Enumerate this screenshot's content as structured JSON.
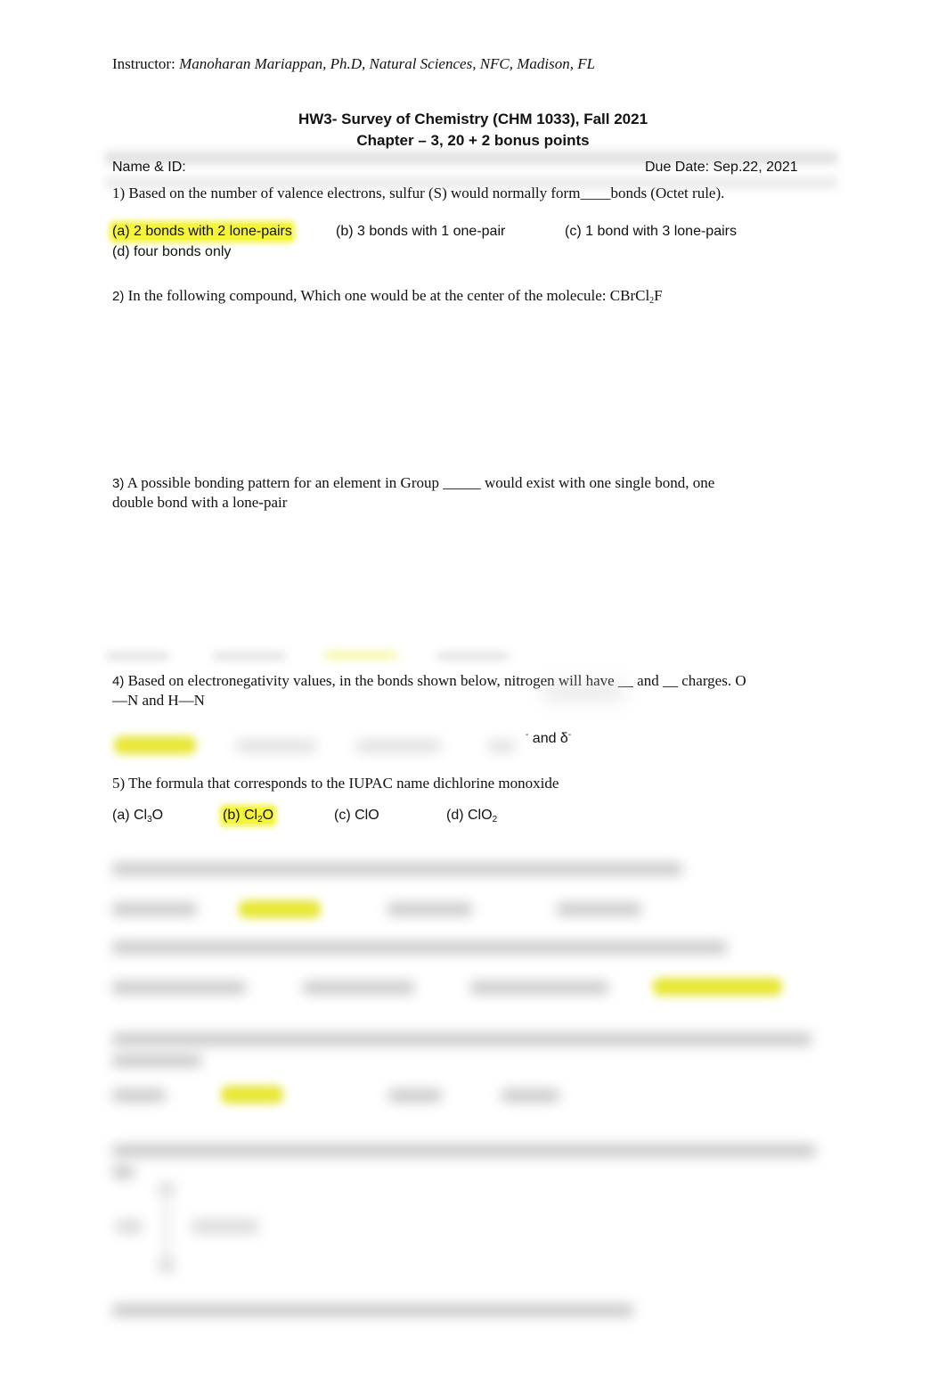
{
  "header": {
    "instructor_label": "Instructor: ",
    "instructor_value": "Manoharan Mariappan, Ph.D, Natural Sciences, NFC, Madison, FL",
    "title_line1": "HW3- Survey of Chemistry (CHM 1033), Fall 2021",
    "title_line2": "Chapter – 3, 20 + 2 bonus points",
    "name_id_label": "Name & ID:",
    "due_date": "Due Date: Sep.22, 2021"
  },
  "questions": {
    "q1": {
      "text": "1) Based on the number of valence electrons, sulfur (S) would normally form____bonds (Octet rule).",
      "options": [
        {
          "label": "(a) 2 bonds with 2 lone-pairs",
          "highlighted": true
        },
        {
          "label": "(b) 3 bonds with 1 one-pair",
          "highlighted": false
        },
        {
          "label": "(c) 1 bond with 3 lone-pairs",
          "highlighted": false
        },
        {
          "label": "(d) four bonds only",
          "highlighted": false
        }
      ]
    },
    "q2": {
      "number": "2)",
      "text": " In the following compound, Which one would be at the center of the molecule: ",
      "formula_pre": "CBrCl",
      "formula_sub": "2",
      "formula_post": "F"
    },
    "q3": {
      "number": "3)",
      "text_line1": " A possible bonding pattern for an element in Group _____ would exist with one single bond, one",
      "text_line2": "double bond with a lone-pair"
    },
    "q4": {
      "number": "4)",
      "text_line1": " Based on electronegativity values, in the bonds shown below, nitrogen will have __ and __ charges.  O",
      "text_line2": "—N   and H—N",
      "visible_option_fragment": " and δ",
      "visible_sup_pre": "-",
      "visible_sup_post": "-"
    },
    "q5": {
      "text": "5) The formula that corresponds to the IUPAC name dichlorine monoxide",
      "options": [
        {
          "prefix": "(a) Cl",
          "sub": "3",
          "suffix": "O",
          "highlighted": false
        },
        {
          "prefix": "(b) Cl",
          "sub": "2",
          "suffix": "O",
          "highlighted": true
        },
        {
          "prefix": "(c) ClO",
          "sub": "",
          "suffix": "",
          "highlighted": false
        },
        {
          "prefix": "(d) ClO",
          "sub": "2",
          "suffix": "",
          "highlighted": false
        }
      ]
    }
  },
  "colors": {
    "highlight": "#f4f43a",
    "text": "#111111"
  }
}
